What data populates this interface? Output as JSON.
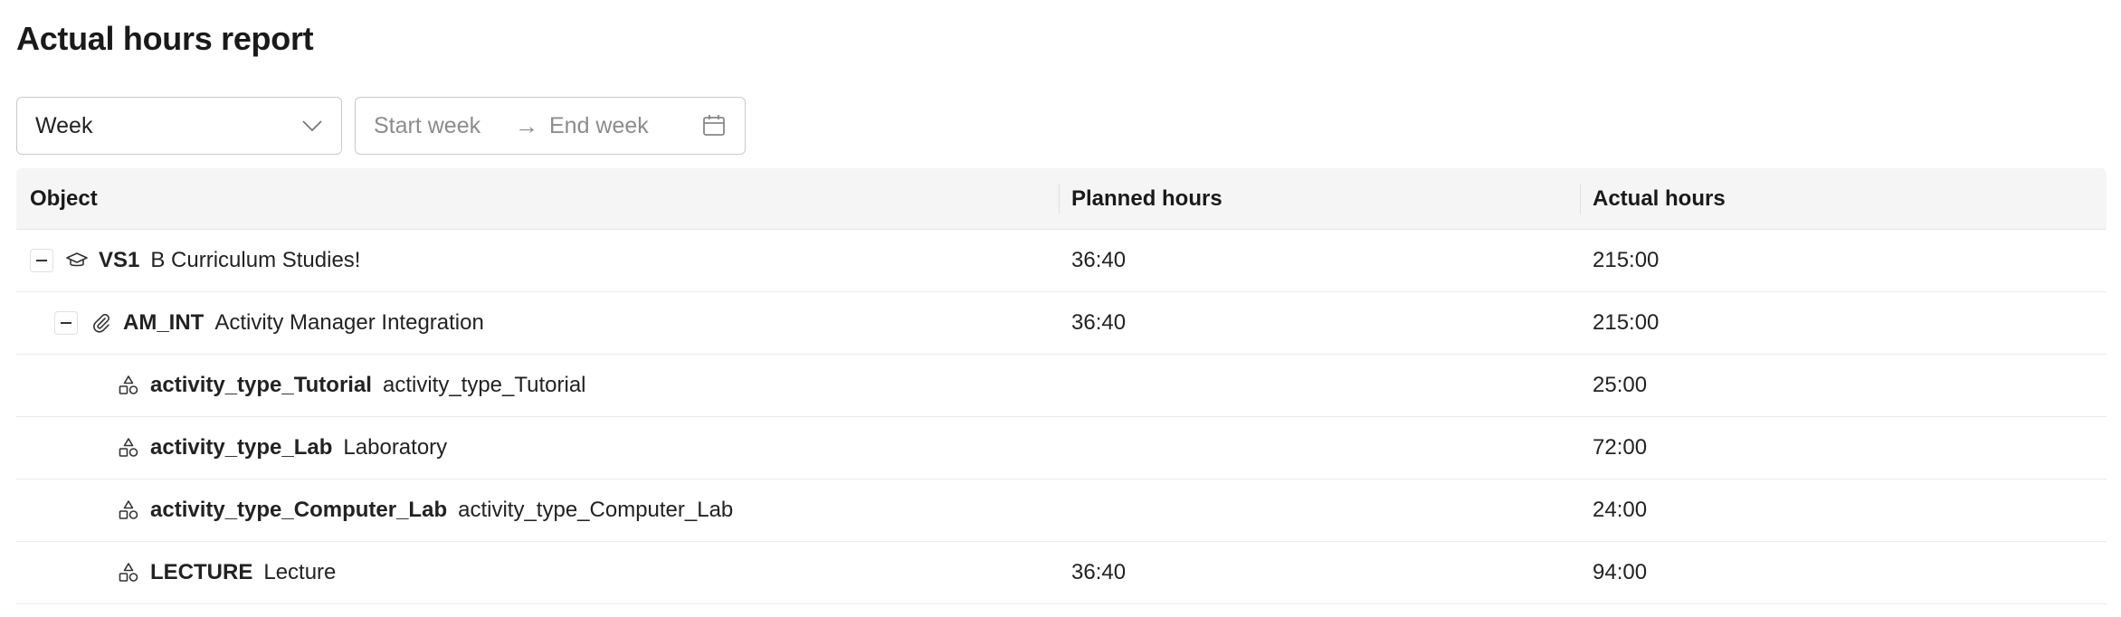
{
  "page": {
    "title": "Actual hours report"
  },
  "filters": {
    "period_select": {
      "value": "Week"
    },
    "range": {
      "start_placeholder": "Start week",
      "separator": "→",
      "end_placeholder": "End week"
    }
  },
  "table": {
    "headers": {
      "object": "Object",
      "planned": "Planned hours",
      "actual": "Actual hours"
    },
    "rows": [
      {
        "icon": "graduation-cap-icon",
        "code": "VS1",
        "name": "B Curriculum Studies!",
        "planned": "36:40",
        "actual": "215:00",
        "expandable": true
      },
      {
        "icon": "paperclip-icon",
        "code": "AM_INT",
        "name": "Activity Manager Integration",
        "planned": "36:40",
        "actual": "215:00",
        "expandable": true
      },
      {
        "icon": "shapes-icon",
        "code": "activity_type_Tutorial",
        "name": "activity_type_Tutorial",
        "planned": "",
        "actual": "25:00",
        "expandable": false
      },
      {
        "icon": "shapes-icon",
        "code": "activity_type_Lab",
        "name": "Laboratory",
        "planned": "",
        "actual": "72:00",
        "expandable": false
      },
      {
        "icon": "shapes-icon",
        "code": "activity_type_Computer_Lab",
        "name": "activity_type_Computer_Lab",
        "planned": "",
        "actual": "24:00",
        "expandable": false
      },
      {
        "icon": "shapes-icon",
        "code": "LECTURE",
        "name": "Lecture",
        "planned": "36:40",
        "actual": "94:00",
        "expandable": false
      }
    ]
  }
}
